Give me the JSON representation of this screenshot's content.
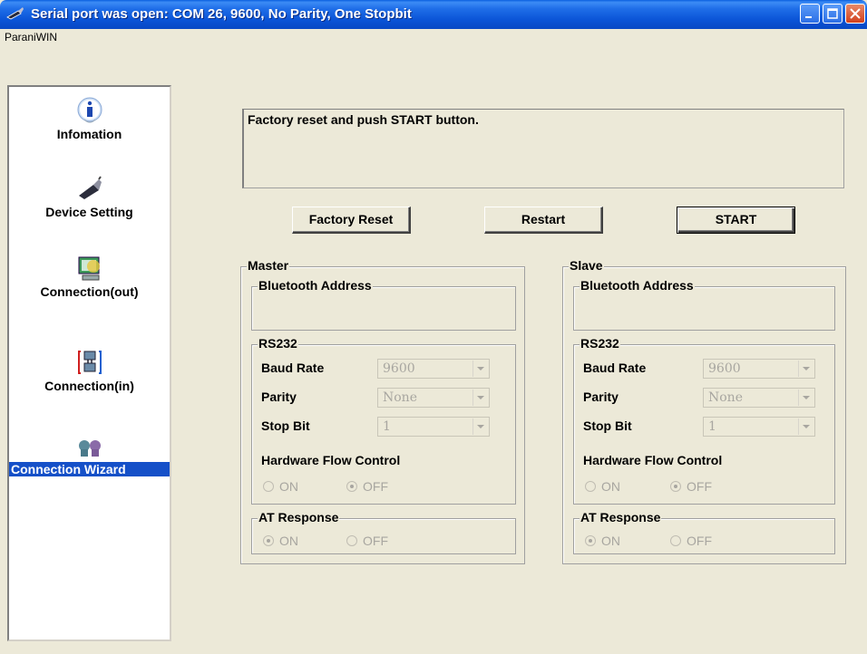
{
  "window": {
    "title": "Serial port was open: COM 26, 9600, No Parity, One Stopbit",
    "menu": "ParaniWIN"
  },
  "sidebar": {
    "items": [
      {
        "label": "Infomation",
        "icon": "info-icon"
      },
      {
        "label": "Device Setting",
        "icon": "usb-device-icon"
      },
      {
        "label": "Connection(out)",
        "icon": "connection-out-icon"
      },
      {
        "label": "Connection(in)",
        "icon": "connection-in-icon"
      },
      {
        "label": "Connection Wizard",
        "icon": "wizard-icon"
      }
    ],
    "active": "Connection Wizard"
  },
  "message": "Factory reset and push START button.",
  "buttons": {
    "factory_reset": "Factory Reset",
    "restart": "Restart",
    "start": "START"
  },
  "master": {
    "title": "Master",
    "bt_address_label": "Bluetooth Address",
    "rs232_label": "RS232",
    "baud_label": "Baud Rate",
    "baud_value": "9600",
    "parity_label": "Parity",
    "parity_value": "None",
    "stop_label": "Stop Bit",
    "stop_value": "1",
    "hfc_label": "Hardware Flow Control",
    "hfc_on": "ON",
    "hfc_off": "OFF",
    "hfc_selected": "OFF",
    "at_label": "AT Response",
    "at_on": "ON",
    "at_off": "OFF",
    "at_selected": "ON"
  },
  "slave": {
    "title": "Slave",
    "bt_address_label": "Bluetooth Address",
    "rs232_label": "RS232",
    "baud_label": "Baud Rate",
    "baud_value": "9600",
    "parity_label": "Parity",
    "parity_value": "None",
    "stop_label": "Stop Bit",
    "stop_value": "1",
    "hfc_label": "Hardware Flow Control",
    "hfc_on": "ON",
    "hfc_off": "OFF",
    "hfc_selected": "OFF",
    "at_label": "AT Response",
    "at_on": "ON",
    "at_off": "OFF",
    "at_selected": "ON"
  },
  "colors": {
    "titlebar": "#0a53d6",
    "window_bg": "#ece9d8",
    "selection": "#1550c8"
  }
}
